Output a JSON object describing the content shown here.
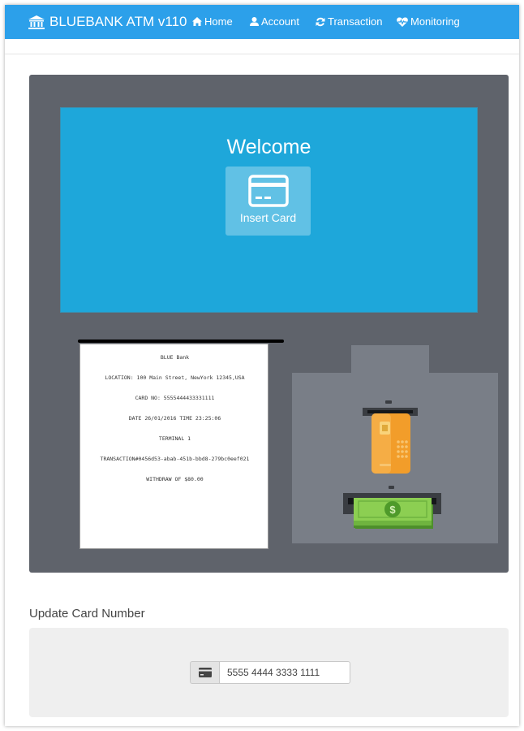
{
  "navbar": {
    "brand": "BLUEBANK ATM v110",
    "items": [
      {
        "label": "Home",
        "icon": "home-icon"
      },
      {
        "label": "Account",
        "icon": "user-icon"
      },
      {
        "label": "Transaction",
        "icon": "refresh-icon"
      },
      {
        "label": "Monitoring",
        "icon": "heartbeat-icon"
      }
    ],
    "color": "#2ca0ea"
  },
  "atm": {
    "body_color": "#5f636b",
    "screen_color": "#1ea7da",
    "welcome": "Welcome",
    "insert_card_label": "Insert Card",
    "receipt": [
      "BLUE Bank",
      "LOCATION: 100 Main Street, NewYork 12345,USA",
      "CARD NO: 5555444433331111",
      "DATE 26/01/2016 TIME 23:25:06",
      "TERMINAL 1",
      "TRANSACTION#0456d53-abab-451b-bbd8-279bc0eef021",
      "WITHDRAW OF $80.00"
    ]
  },
  "update_card": {
    "title": "Update Card Number",
    "card_number": "5555 4444 3333 1111"
  }
}
